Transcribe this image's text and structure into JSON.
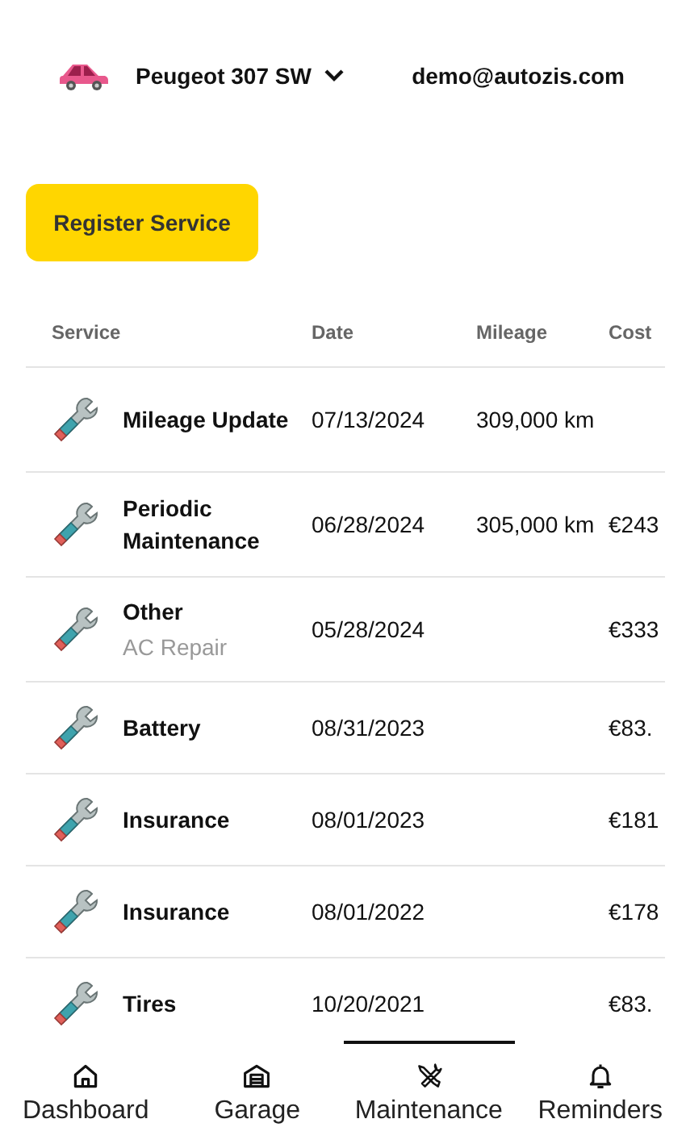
{
  "header": {
    "vehicle": "Peugeot 307 SW",
    "user": "demo@autozis.com"
  },
  "register_button": "Register Service",
  "table": {
    "columns": [
      "Service",
      "Date",
      "Mileage",
      "Cost"
    ],
    "rows": [
      {
        "service": "Mileage Update",
        "date": "07/13/2024",
        "mileage": "309,000 km"
      },
      {
        "service": "Periodic Maintenance",
        "date": "06/28/2024",
        "mileage": "305,000 km",
        "cost": "€243"
      },
      {
        "service": "Other",
        "note": "AC Repair",
        "date": "05/28/2024",
        "cost": "€333"
      },
      {
        "service": "Battery",
        "date": "08/31/2023",
        "cost": "€83."
      },
      {
        "service": "Insurance",
        "date": "08/01/2023",
        "cost": "€181"
      },
      {
        "service": "Insurance",
        "date": "08/01/2022",
        "cost": "€178"
      },
      {
        "service": "Tires",
        "date": "10/20/2021",
        "cost": "€83."
      }
    ]
  },
  "bottom_nav": [
    {
      "label": "Dashboard",
      "kind": "home",
      "selected": false
    },
    {
      "label": "Garage",
      "kind": "garage",
      "selected": false
    },
    {
      "label": "Maintenance",
      "kind": "tools",
      "selected": true
    },
    {
      "label": "Reminders",
      "kind": "bell",
      "selected": false
    }
  ]
}
